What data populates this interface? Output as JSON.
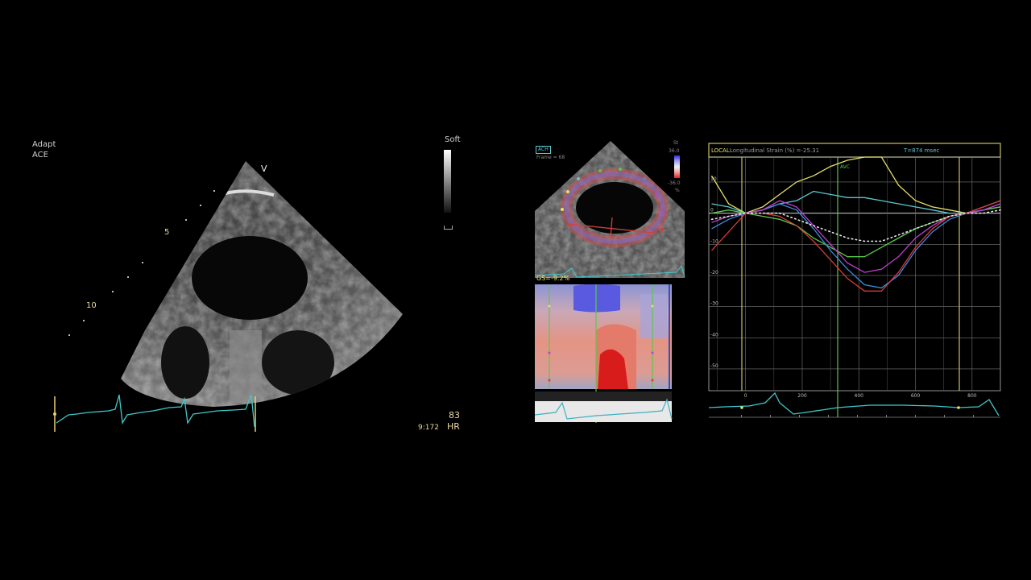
{
  "left_panel": {
    "mode_line1": "Adapt",
    "mode_line2": "ACE",
    "probe_marker": "V",
    "depth_5": "5",
    "depth_10": "10",
    "gray_map_label": "Soft",
    "hr_value": "83",
    "hr_label": "HR",
    "frame_counter": "9:172"
  },
  "middle_panel": {
    "view_tag": "ACH",
    "frame_label": "Frame = 68",
    "scale_title": "St",
    "scale_max": "36.0",
    "scale_min": "-36.0",
    "scale_unit": "%",
    "gs_label": "GS=-9.2%"
  },
  "chart_data": {
    "type": "line",
    "header_left_prefix": "LOCAL:",
    "header_left_text": "Longitudinal Strain (%) =-25.31",
    "header_right": "T=874 msec",
    "marker_label": "AVC",
    "xlim": [
      -130,
      900
    ],
    "ylim": [
      -57,
      18
    ],
    "x_ticks": [
      0,
      200,
      400,
      600,
      800
    ],
    "y_ticks": [
      10,
      0,
      -10,
      -20,
      -30,
      -40,
      -50
    ],
    "x": [
      -120,
      -60,
      0,
      60,
      120,
      180,
      240,
      300,
      360,
      420,
      480,
      540,
      600,
      660,
      720,
      780,
      840,
      900
    ],
    "series": [
      {
        "color": "#e6e06a",
        "values": [
          12,
          3,
          0,
          2,
          6,
          10,
          12,
          15,
          17,
          18,
          18,
          9,
          4,
          2,
          1,
          0,
          1,
          2
        ]
      },
      {
        "color": "#5cc8d0",
        "values": [
          3,
          2,
          0,
          1,
          3,
          4,
          7,
          6,
          5,
          5,
          4,
          3,
          2,
          1,
          0,
          0,
          2,
          4
        ]
      },
      {
        "color": "#5bc84c",
        "values": [
          0,
          1,
          0,
          -1,
          -2,
          -4,
          -8,
          -11,
          -14,
          -14,
          -11,
          -8,
          -5,
          -3,
          -1,
          0,
          1,
          2
        ]
      },
      {
        "color": "#3a8de0",
        "values": [
          -5,
          -2,
          0,
          1,
          3,
          1,
          -5,
          -12,
          -18,
          -23,
          -24,
          -20,
          -12,
          -6,
          -2,
          0,
          1,
          3
        ]
      },
      {
        "color": "#c040d0",
        "values": [
          -3,
          -1,
          0,
          1,
          4,
          2,
          -4,
          -10,
          -16,
          -19,
          -18,
          -14,
          -8,
          -4,
          -1,
          0,
          1,
          3
        ]
      },
      {
        "color": "#d83a3a",
        "values": [
          -12,
          -6,
          0,
          0,
          -1,
          -4,
          -9,
          -15,
          -21,
          -25,
          -25,
          -19,
          -11,
          -5,
          -1,
          0,
          2,
          4
        ]
      },
      {
        "color": "#e8e8e8",
        "dashed": true,
        "values": [
          -2,
          -1,
          0,
          0,
          0,
          -2,
          -4,
          -6,
          -8,
          -9,
          -9,
          -7,
          -5,
          -3,
          -1,
          0,
          0,
          1
        ]
      }
    ]
  }
}
